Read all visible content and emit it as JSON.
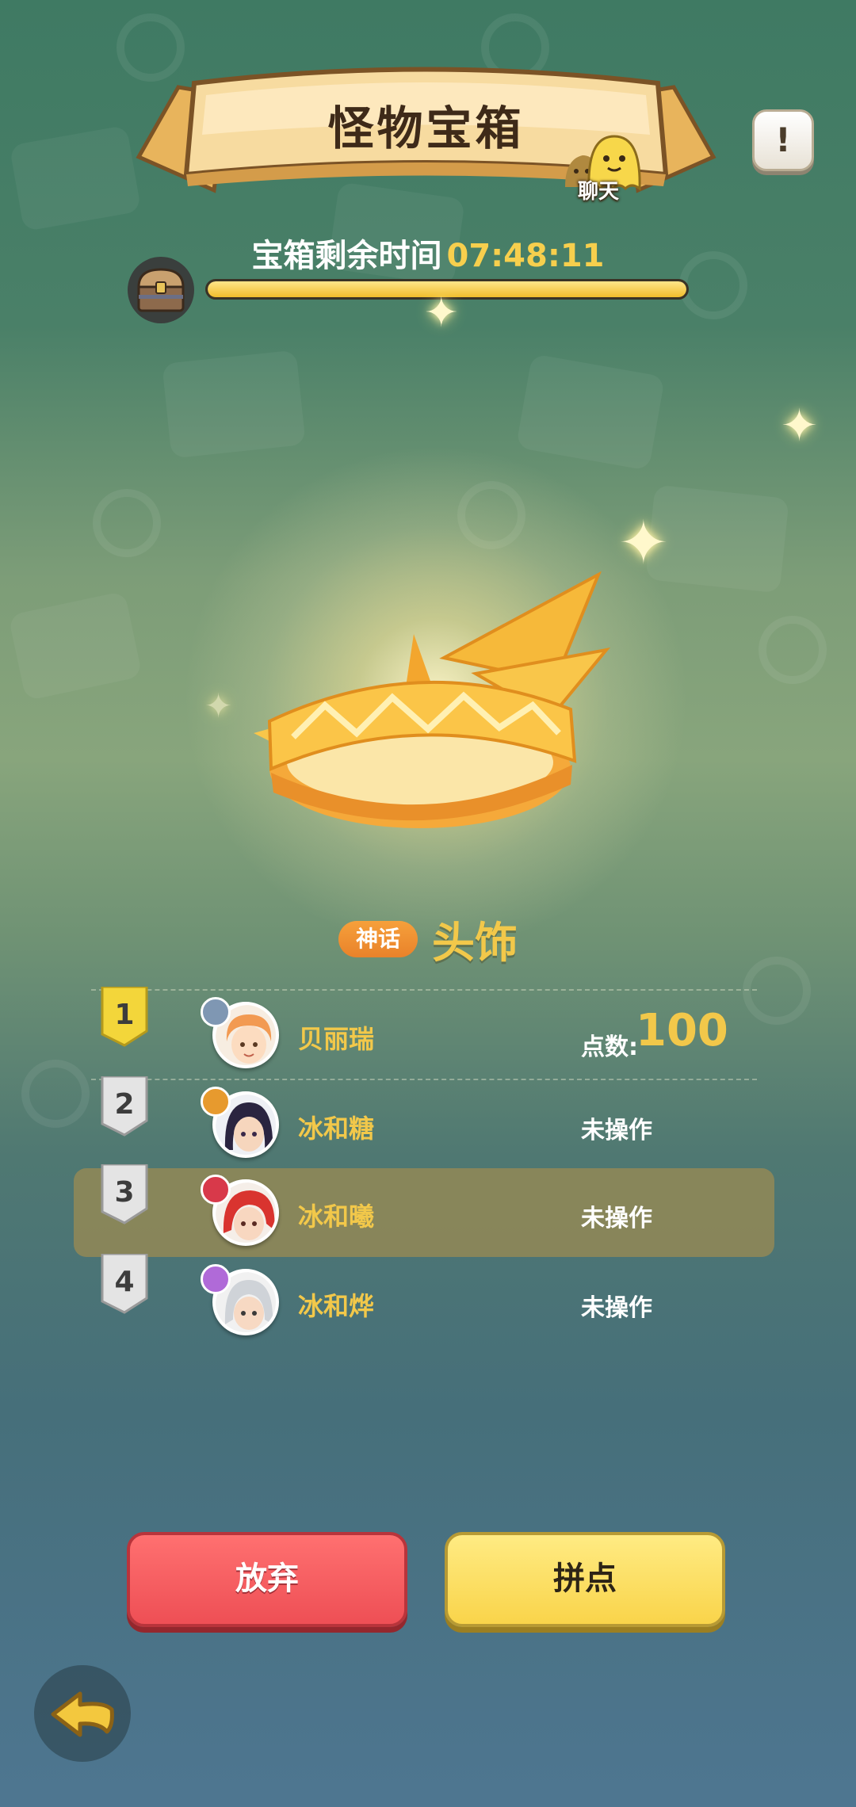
{
  "header": {
    "title": "怪物宝箱",
    "chat_label": "聊天",
    "info_icon": "exclamation-icon"
  },
  "timer": {
    "label": "宝箱剩余时间",
    "value": "07:48:11",
    "progress": 1.0
  },
  "item": {
    "rarity": "神话",
    "name": "头饰",
    "icon": "crown-headband-icon"
  },
  "players": [
    {
      "rank": "1",
      "name": "贝丽瑞",
      "score_label": "点数:",
      "score": "100",
      "status": ""
    },
    {
      "rank": "2",
      "name": "冰和糖",
      "status": "未操作"
    },
    {
      "rank": "3",
      "name": "冰和曦",
      "status": "未操作",
      "highlight": true
    },
    {
      "rank": "4",
      "name": "冰和烨",
      "status": "未操作"
    }
  ],
  "buttons": {
    "give_up": "放弃",
    "bid": "拼点"
  },
  "footer": {
    "back_icon": "back-arrow-icon"
  },
  "colors": {
    "accent_gold": "#f2c84a",
    "give_up_red": "#ee4f55",
    "bid_yellow": "#f9d44a",
    "rarity_orange": "#e9822a"
  }
}
